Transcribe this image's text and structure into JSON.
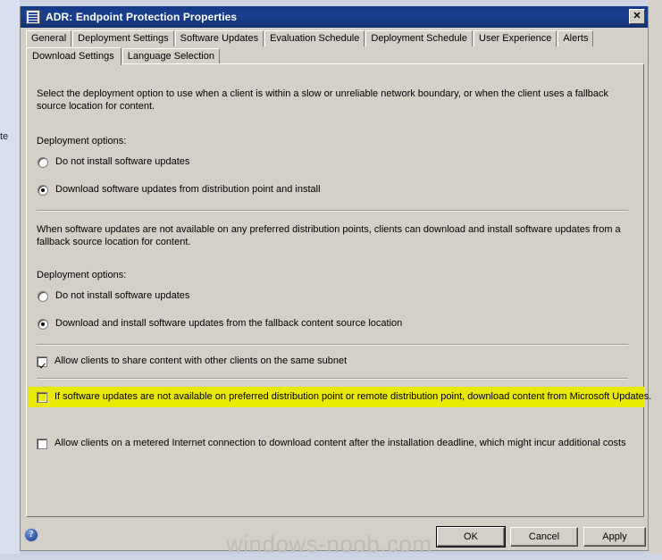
{
  "window": {
    "title": "ADR: Endpoint Protection Properties",
    "icon": "properties-window-icon",
    "close_label": "✕"
  },
  "background": {
    "left_fragment_text": "te"
  },
  "tabs": {
    "row1": [
      {
        "label": "General",
        "selected": false
      },
      {
        "label": "Deployment Settings",
        "selected": false
      },
      {
        "label": "Software Updates",
        "selected": false
      },
      {
        "label": "Evaluation Schedule",
        "selected": false
      },
      {
        "label": "Deployment Schedule",
        "selected": false
      },
      {
        "label": "User Experience",
        "selected": false
      },
      {
        "label": "Alerts",
        "selected": false
      }
    ],
    "row2": [
      {
        "label": "Download Settings",
        "selected": true
      },
      {
        "label": "Language Selection",
        "selected": false
      }
    ]
  },
  "panel": {
    "intro_paragraph": "Select the deployment option to use when a client is within a slow or unreliable network boundary, or when the client uses a fallback source location for content.",
    "group1": {
      "legend": "Deployment options:",
      "options": [
        {
          "label": "Do not install software updates",
          "checked": false
        },
        {
          "label": "Download software updates from distribution point and install",
          "checked": true
        }
      ]
    },
    "fallback_paragraph": "When software updates are not available on any preferred distribution points, clients can download and install software updates from a fallback source location for content.",
    "group2": {
      "legend": "Deployment options:",
      "options": [
        {
          "label": "Do not install software updates",
          "checked": false
        },
        {
          "label": "Download and install software updates from the fallback content source location",
          "checked": true
        }
      ]
    },
    "checkboxes": [
      {
        "label": "Allow clients to share content with other clients on the same subnet",
        "checked": true,
        "highlighted": false
      },
      {
        "label": "If software updates are not available on preferred distribution point or remote distribution point, download content from Microsoft Updates.",
        "checked": false,
        "highlighted": true
      },
      {
        "label": "Allow clients on a metered Internet connection to download content after the installation deadline, which might incur additional costs",
        "checked": false,
        "highlighted": false
      }
    ]
  },
  "footer": {
    "help_label": "?",
    "ok_label": "OK",
    "cancel_label": "Cancel",
    "apply_label": "Apply"
  },
  "watermark": {
    "text": "windows-noob.com"
  },
  "colors": {
    "titlebar": "#13388a",
    "dialog_face": "#d4d0c8",
    "highlight": "#e8e800",
    "desktop": "#c8d0e4",
    "watermark_text": "#c0bcb4"
  }
}
